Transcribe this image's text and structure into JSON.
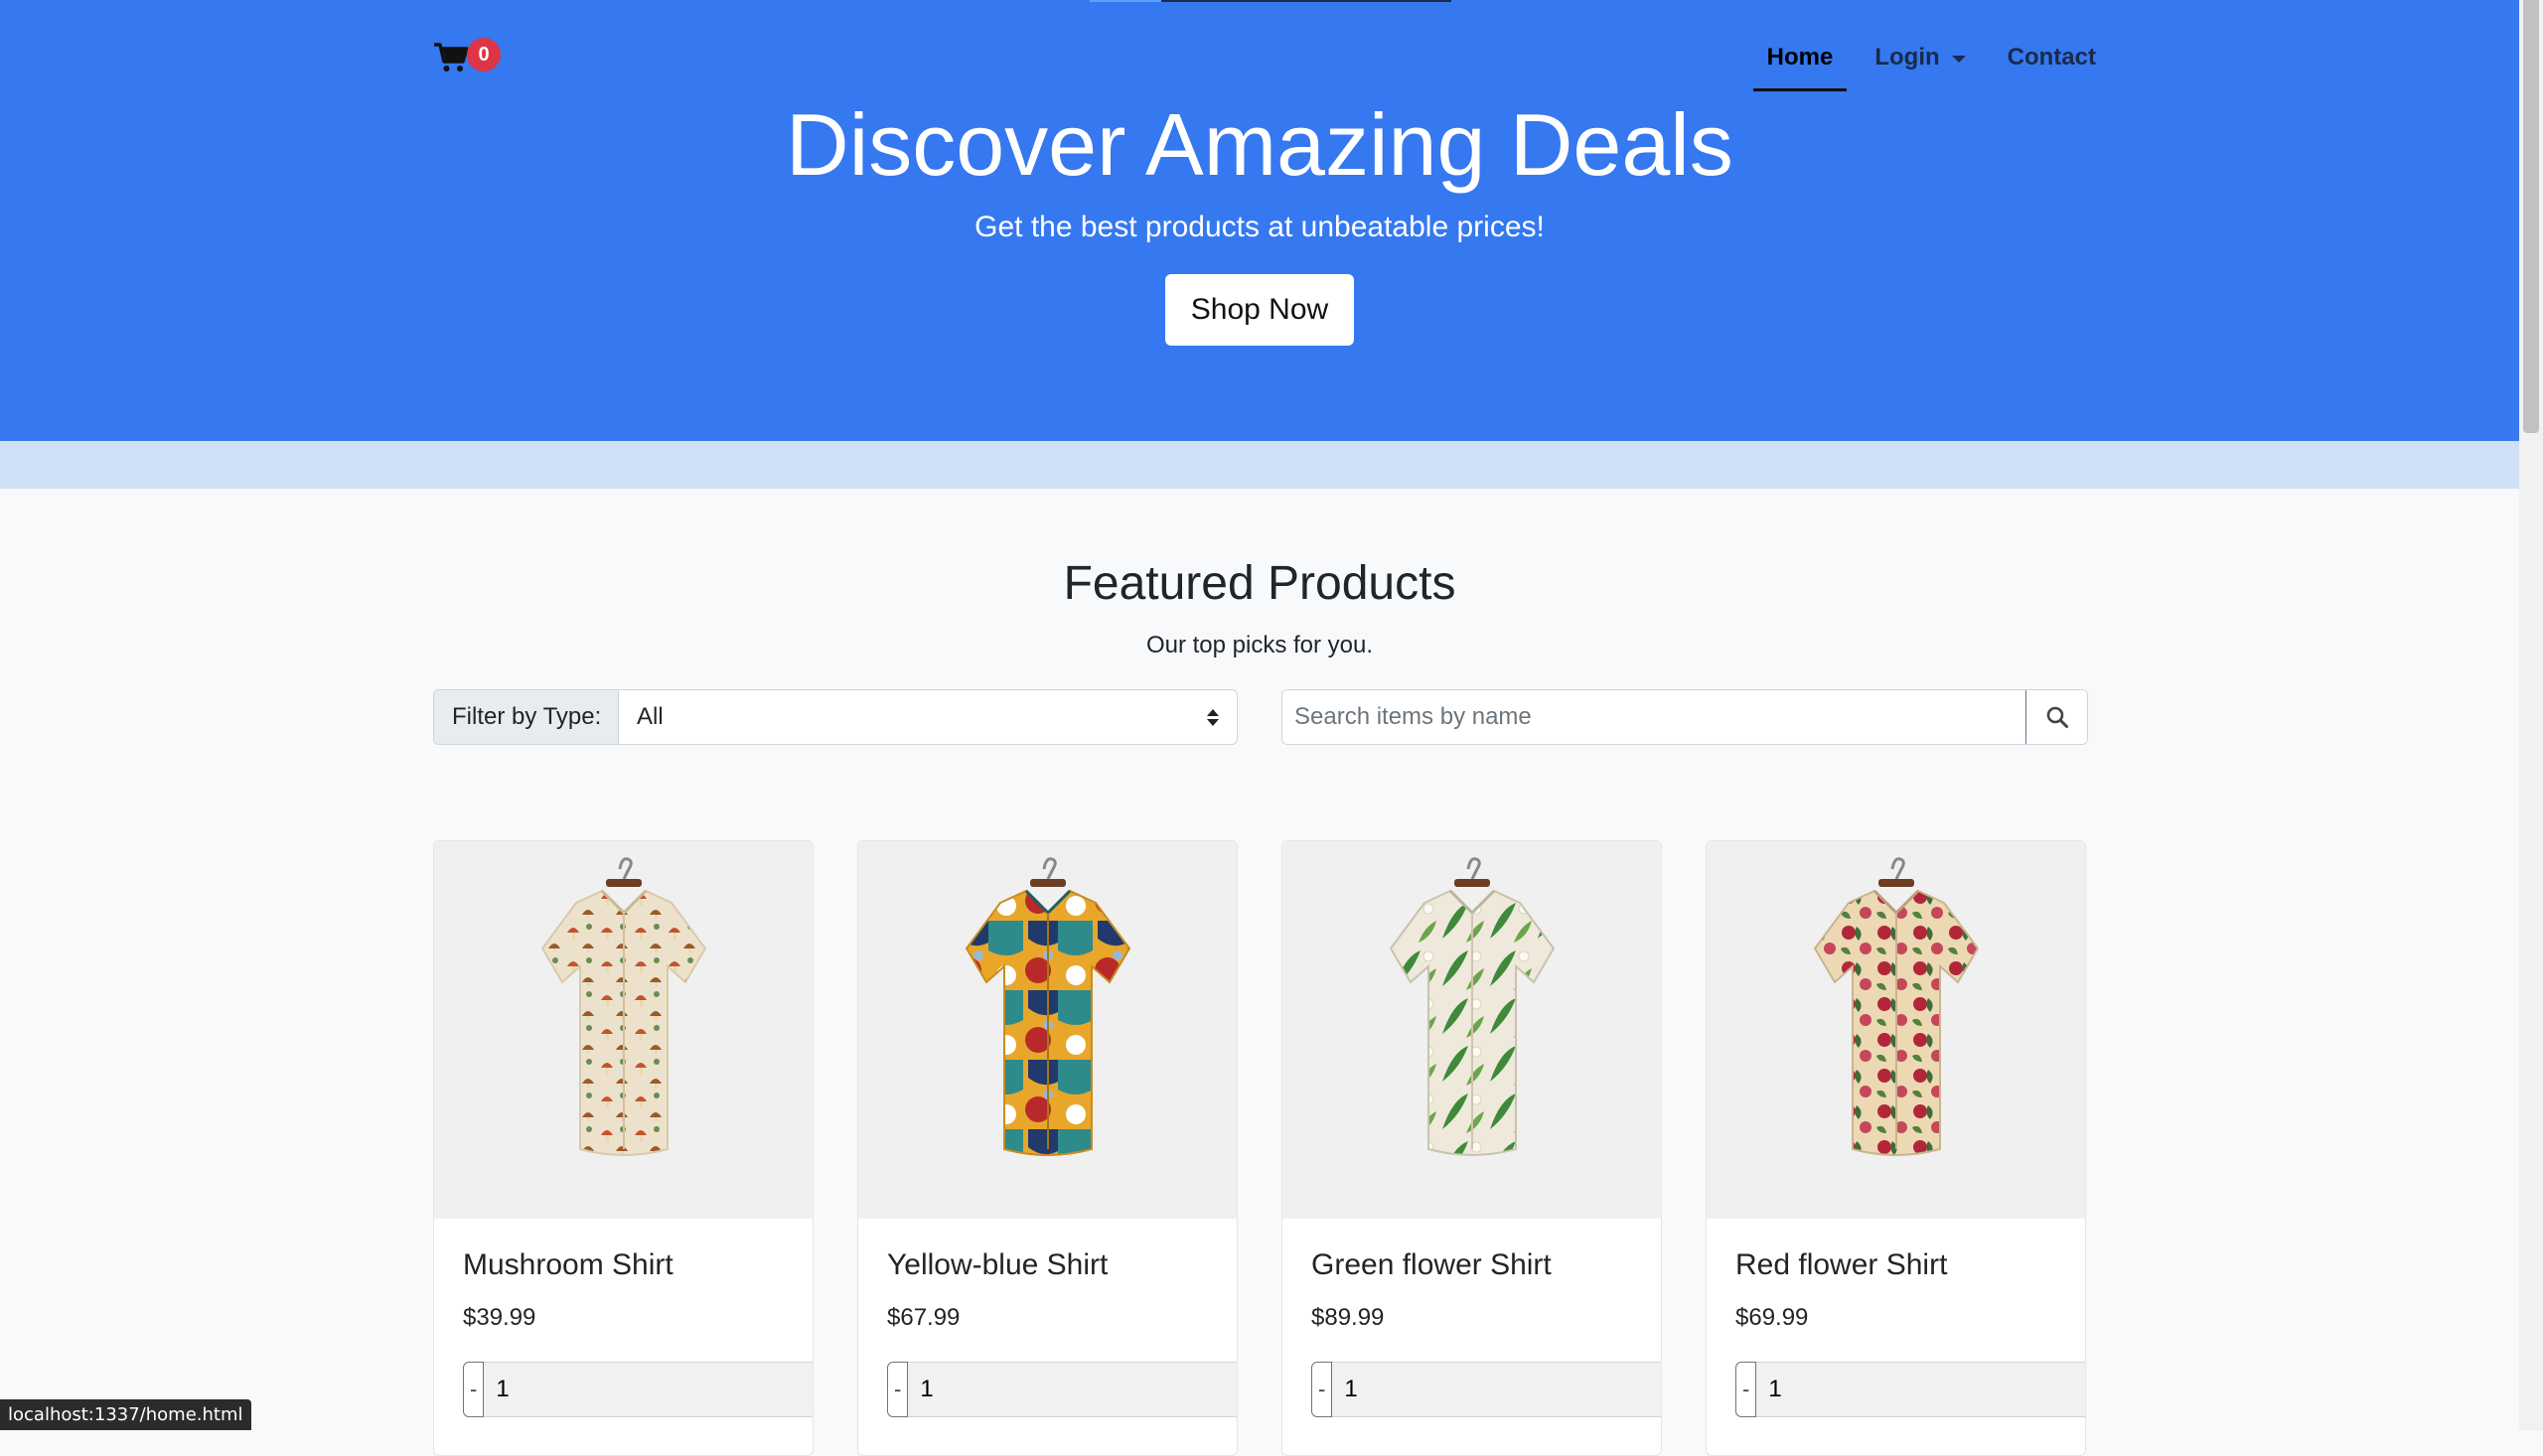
{
  "colors": {
    "hero_bg": "#3578f0",
    "band_bg": "#cfe0f7",
    "badge_bg": "#dc3545",
    "page_bg": "#f8f9fa"
  },
  "header": {
    "cart": {
      "icon": "shopping-cart-icon",
      "count": "0"
    },
    "nav": [
      {
        "label": "Home",
        "active": true
      },
      {
        "label": "Login",
        "dropdown": true
      },
      {
        "label": "Contact"
      }
    ]
  },
  "hero": {
    "title": "Discover Amazing Deals",
    "subtitle": "Get the best products at unbeatable prices!",
    "cta_label": "Shop Now"
  },
  "featured": {
    "title": "Featured Products",
    "subtitle": "Our top picks for you.",
    "filter": {
      "label": "Filter by Type:",
      "selected": "All"
    },
    "search": {
      "placeholder": "Search items by name",
      "icon": "search-icon"
    }
  },
  "products": [
    {
      "name": "Mushroom Shirt",
      "price": "$39.99",
      "qty": "1",
      "pattern": "mushroom-print"
    },
    {
      "name": "Yellow-blue Shirt",
      "price": "$67.99",
      "qty": "1",
      "pattern": "abstract-print"
    },
    {
      "name": "Green flower Shirt",
      "price": "$89.99",
      "qty": "1",
      "pattern": "green-leaf-print"
    },
    {
      "name": "Red flower Shirt",
      "price": "$69.99",
      "qty": "1",
      "pattern": "red-floral-print"
    }
  ],
  "qty_labels": {
    "minus": "-",
    "plus": "+"
  },
  "status_bar": {
    "url": "localhost:1337/home.html"
  }
}
